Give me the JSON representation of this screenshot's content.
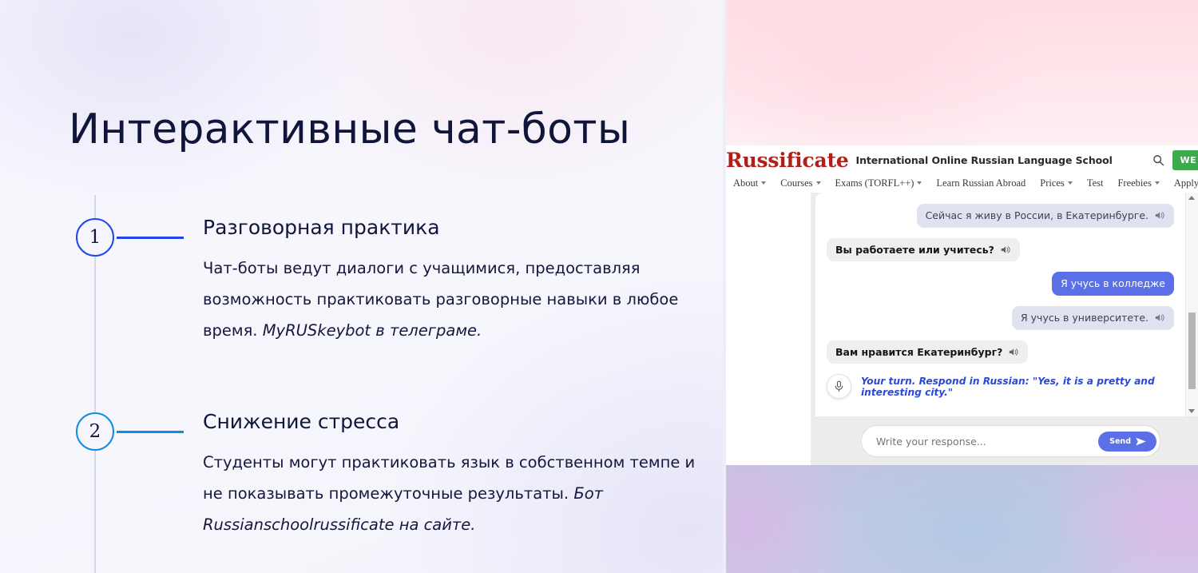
{
  "slide": {
    "title": "Интерактивные чат-боты",
    "items": [
      {
        "number": "1",
        "heading": "Разговорная практика",
        "desc_plain": "Чат-боты ведут диалоги с учащимися, предоставляя возможность практиковать разговорные навыки в любое время. ",
        "desc_em": "MyRUSkeybot в телеграме.",
        "accent": "#1f46ee"
      },
      {
        "number": "2",
        "heading": "Снижение стресса",
        "desc_plain": "Студенты могут практиковать язык в собственном темпе и не показывать промежуточные результаты. ",
        "desc_em": "Бот Russianschoolrussificate на сайте.",
        "accent": "#0e8ede"
      }
    ]
  },
  "site": {
    "logo": "Russificate",
    "tagline": "International Online Russian Language School",
    "logo_color": "#b0201a",
    "search_icon": "search-icon",
    "cta_label": "WE AR",
    "cta_color": "#3bab4d",
    "nav": [
      {
        "label": "About",
        "caret": true
      },
      {
        "label": "Courses",
        "caret": true
      },
      {
        "label": "Exams (TORFL++)",
        "caret": true
      },
      {
        "label": "Learn Russian Abroad",
        "caret": false
      },
      {
        "label": "Prices",
        "caret": true
      },
      {
        "label": "Test",
        "caret": false
      },
      {
        "label": "Freebies",
        "caret": true
      },
      {
        "label": "Apply",
        "caret": false
      }
    ],
    "flag_icon": "us-flag-icon"
  },
  "chat": {
    "messages": [
      {
        "side": "right",
        "style": "userq",
        "text": "Сейчас я живу в России, в Екатеринбурге.",
        "speaker_icon": "speaker-icon"
      },
      {
        "side": "left",
        "style": "bot",
        "text": "Вы работаете или учитесь?",
        "speaker_icon": "speaker-icon"
      },
      {
        "side": "right",
        "style": "mine",
        "text": "Я учусь в колледже",
        "speaker_icon": ""
      },
      {
        "side": "right",
        "style": "userq",
        "text": "Я учусь в университете.",
        "speaker_icon": "speaker-icon"
      },
      {
        "side": "left",
        "style": "bot",
        "text": "Вам нравится Екатеринбург?",
        "speaker_icon": "speaker-icon"
      }
    ],
    "prompt": "Your turn. Respond in Russian: \"Yes, it is a pretty and interesting city.\"",
    "prompt_color": "#2b49d6",
    "mic_icon": "microphone-icon",
    "composer_placeholder": "Write your response...",
    "send_label": "Send",
    "send_icon": "send-arrow-icon",
    "send_color": "#5a6fe8",
    "scrollbar": {
      "up_icon": "scroll-up-arrow-icon",
      "down_icon": "scroll-down-arrow-icon"
    }
  }
}
